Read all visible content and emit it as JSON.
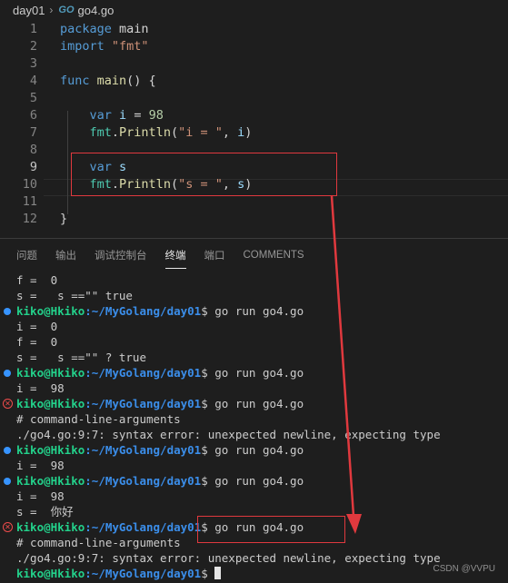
{
  "breadcrumb": {
    "folder": "day01",
    "go_icon": "GO",
    "file": "go4.go"
  },
  "editor": {
    "lines": [
      {
        "num": "1",
        "tokens": [
          [
            "kw",
            "package"
          ],
          [
            "plain",
            " "
          ],
          [
            "plain",
            "main"
          ]
        ]
      },
      {
        "num": "2",
        "tokens": [
          [
            "kw",
            "import"
          ],
          [
            "plain",
            " "
          ],
          [
            "str",
            "\"fmt\""
          ]
        ]
      },
      {
        "num": "3",
        "tokens": []
      },
      {
        "num": "4",
        "tokens": [
          [
            "kw",
            "func"
          ],
          [
            "plain",
            " "
          ],
          [
            "fn",
            "main"
          ],
          [
            "plain",
            "() {"
          ]
        ]
      },
      {
        "num": "5",
        "tokens": []
      },
      {
        "num": "6",
        "tokens": [
          [
            "plain",
            "    "
          ],
          [
            "kw",
            "var"
          ],
          [
            "plain",
            " "
          ],
          [
            "id",
            "i"
          ],
          [
            "plain",
            " = "
          ],
          [
            "num",
            "98"
          ]
        ]
      },
      {
        "num": "7",
        "tokens": [
          [
            "plain",
            "    "
          ],
          [
            "pkg",
            "fmt"
          ],
          [
            "plain",
            "."
          ],
          [
            "fn",
            "Println"
          ],
          [
            "plain",
            "("
          ],
          [
            "str",
            "\"i = \""
          ],
          [
            "plain",
            ", "
          ],
          [
            "id",
            "i"
          ],
          [
            "plain",
            ")"
          ]
        ]
      },
      {
        "num": "8",
        "tokens": []
      },
      {
        "num": "9",
        "tokens": [
          [
            "plain",
            "    "
          ],
          [
            "kw",
            "var"
          ],
          [
            "plain",
            " "
          ],
          [
            "id",
            "s"
          ]
        ]
      },
      {
        "num": "10",
        "tokens": [
          [
            "plain",
            "    "
          ],
          [
            "pkg",
            "fmt"
          ],
          [
            "plain",
            "."
          ],
          [
            "fn",
            "Println"
          ],
          [
            "plain",
            "("
          ],
          [
            "str",
            "\"s = \""
          ],
          [
            "plain",
            ", "
          ],
          [
            "id",
            "s"
          ],
          [
            "plain",
            ")"
          ]
        ]
      },
      {
        "num": "11",
        "tokens": []
      },
      {
        "num": "12",
        "tokens": [
          [
            "plain",
            "}"
          ]
        ]
      }
    ]
  },
  "panel": {
    "tabs": [
      "问题",
      "输出",
      "调试控制台",
      "终端",
      "端口",
      "COMMENTS"
    ],
    "active_tab": 3
  },
  "terminal": {
    "user": "kiko@Hkiko",
    "path": ":~/MyGolang/day01",
    "lines": [
      {
        "type": "out",
        "text": "f =  0"
      },
      {
        "type": "out",
        "text": "s =   s ==\"\" true"
      },
      {
        "type": "prompt",
        "marker": "info",
        "cmd": " go run go4.go"
      },
      {
        "type": "out",
        "text": "i =  0"
      },
      {
        "type": "out",
        "text": "f =  0"
      },
      {
        "type": "out",
        "text": "s =   s ==\"\" ? true"
      },
      {
        "type": "prompt",
        "marker": "info",
        "cmd": " go run go4.go"
      },
      {
        "type": "out",
        "text": "i =  98"
      },
      {
        "type": "prompt",
        "marker": "error",
        "cmd": " go run go4.go"
      },
      {
        "type": "out",
        "text": "# command-line-arguments"
      },
      {
        "type": "out",
        "text": "./go4.go:9:7: syntax error: unexpected newline, expecting type"
      },
      {
        "type": "prompt",
        "marker": "info",
        "cmd": " go run go4.go"
      },
      {
        "type": "out",
        "text": "i =  98"
      },
      {
        "type": "prompt",
        "marker": "info",
        "cmd": " go run go4.go"
      },
      {
        "type": "out",
        "text": "i =  98"
      },
      {
        "type": "out",
        "text": "s =  你好"
      },
      {
        "type": "prompt",
        "marker": "error",
        "cmd": " go run go4.go"
      },
      {
        "type": "out",
        "text": "# command-line-arguments"
      },
      {
        "type": "out",
        "text": "./go4.go:9:7: syntax error: unexpected newline, expecting type"
      },
      {
        "type": "prompt",
        "marker": "none",
        "cmd": " ",
        "cursor": true
      }
    ]
  },
  "watermark": "CSDN @VVPU",
  "colors": {
    "annotation": "#e0393e",
    "prompt_user": "#23d18b",
    "prompt_path": "#3b8eea",
    "error": "#f14c4c",
    "info": "#3794ff"
  }
}
